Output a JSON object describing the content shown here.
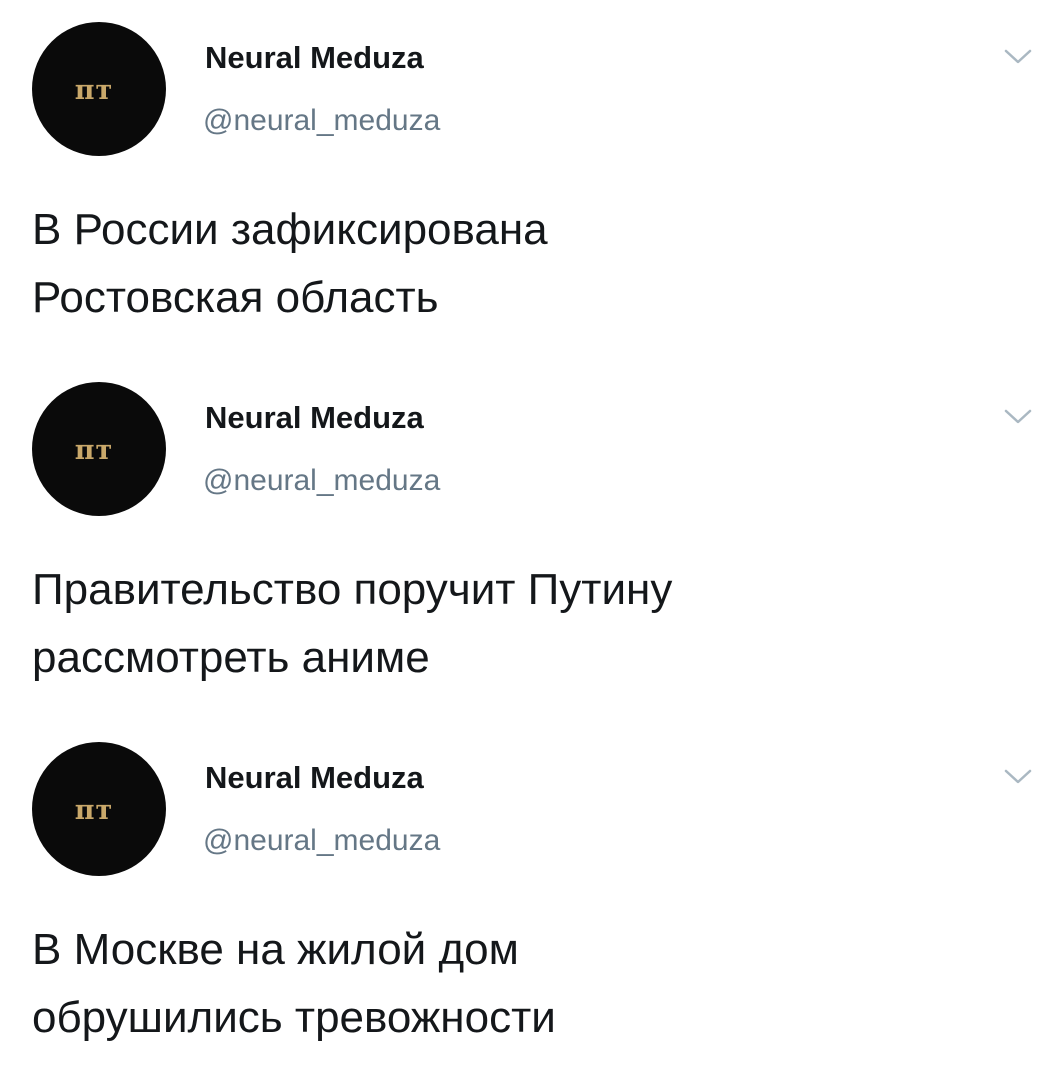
{
  "tweets": [
    {
      "avatar_text": "пт",
      "name": "Neural Meduza",
      "handle": "@neural_meduza",
      "text": "В России зафиксирована\nРостовская область"
    },
    {
      "avatar_text": "пт",
      "name": "Neural Meduza",
      "handle": "@neural_meduza",
      "text": "Правительство поручит Путину\nрассмотреть аниме"
    },
    {
      "avatar_text": "пт",
      "name": "Neural Meduza",
      "handle": "@neural_meduza",
      "text": "В Москве на жилой дом\nобрушились тревожности"
    }
  ],
  "colors": {
    "text_primary": "#14171a",
    "text_secondary": "#657786",
    "avatar_bg": "#0a0a0a",
    "avatar_logo": "#c9a86a",
    "chevron": "#aab8c2"
  },
  "icons": {
    "chevron": "chevron-down-icon"
  }
}
